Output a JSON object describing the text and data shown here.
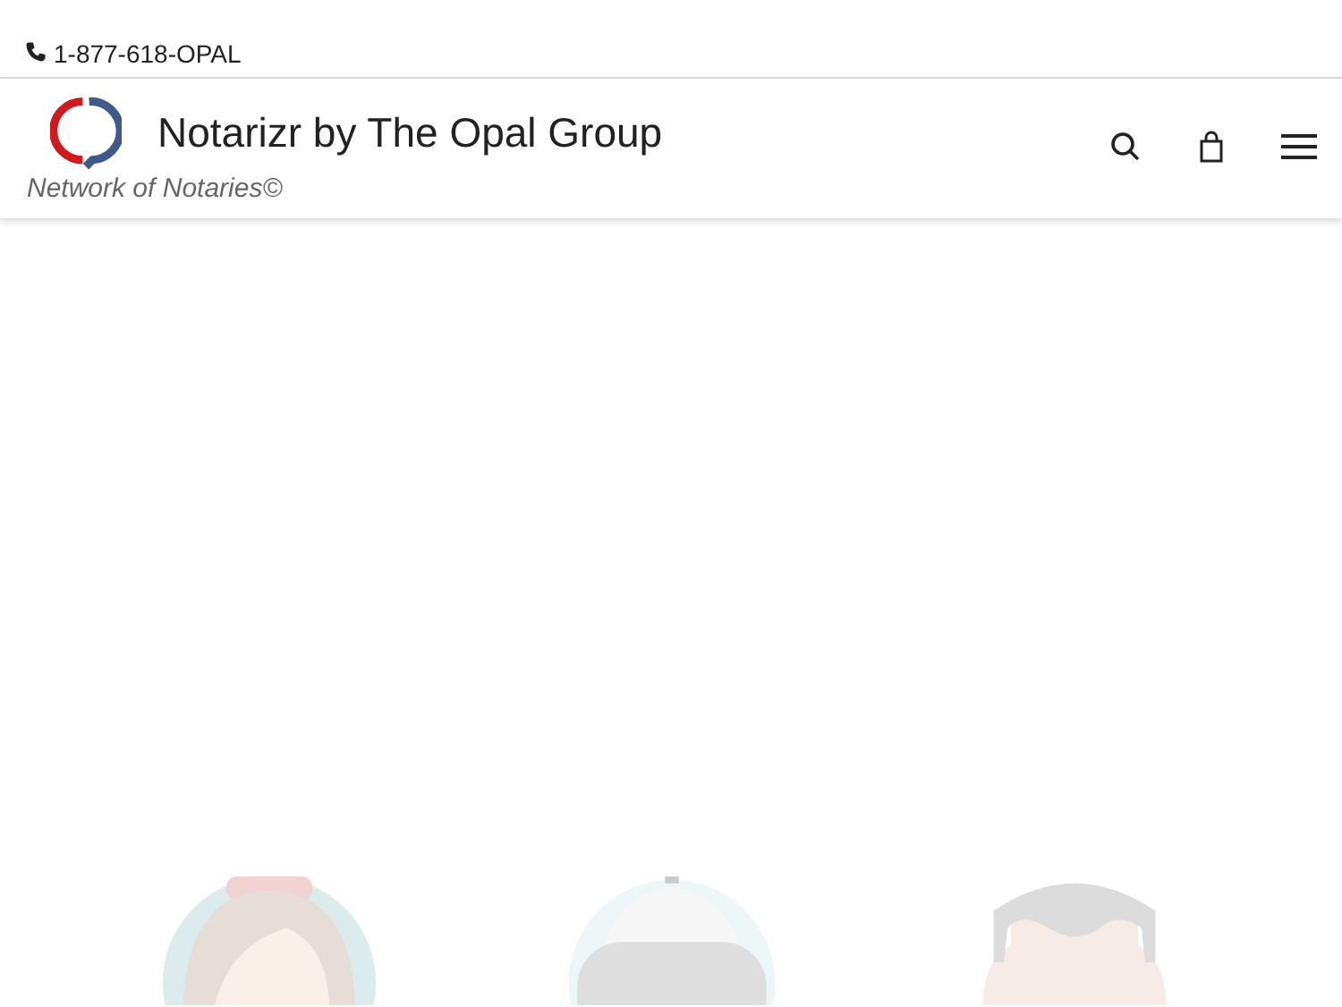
{
  "top_bar": {
    "phone": "1-877-618-OPAL"
  },
  "header": {
    "brand": "Notarizr by The Opal Group",
    "tagline": "Network of Notaries©"
  },
  "illustrations": [
    {
      "kind": "woman"
    },
    {
      "kind": "robot"
    },
    {
      "kind": "man"
    }
  ]
}
